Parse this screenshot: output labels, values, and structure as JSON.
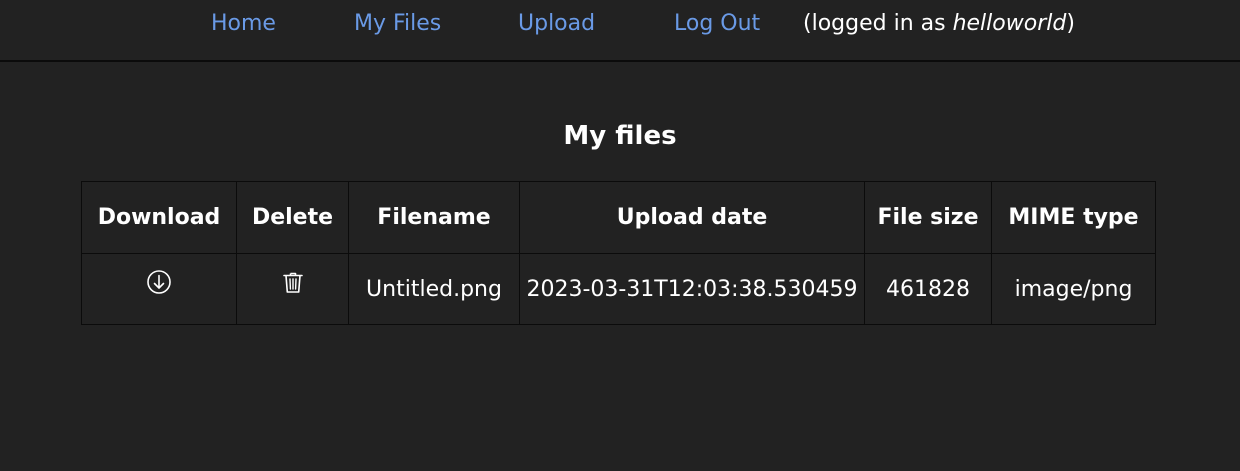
{
  "nav": {
    "home": "Home",
    "my_files": "My Files",
    "upload": "Upload",
    "log_out": "Log Out",
    "login_prefix": "(logged in as ",
    "username": "helloworld",
    "login_suffix": ")"
  },
  "main": {
    "title": "My files",
    "columns": [
      "Download",
      "Delete",
      "Filename",
      "Upload date",
      "File size",
      "MIME type"
    ],
    "rows": [
      {
        "download_icon": "download-circle-icon",
        "delete_icon": "trash-icon",
        "filename": "Untitled.png",
        "upload_date": "2023-03-31T12:03:38.530459",
        "file_size": "461828",
        "mime_type": "image/png"
      }
    ]
  },
  "colors": {
    "background": "#222222",
    "link": "#6a9ae6",
    "text": "#ffffff",
    "border": "#0b0b0b"
  }
}
